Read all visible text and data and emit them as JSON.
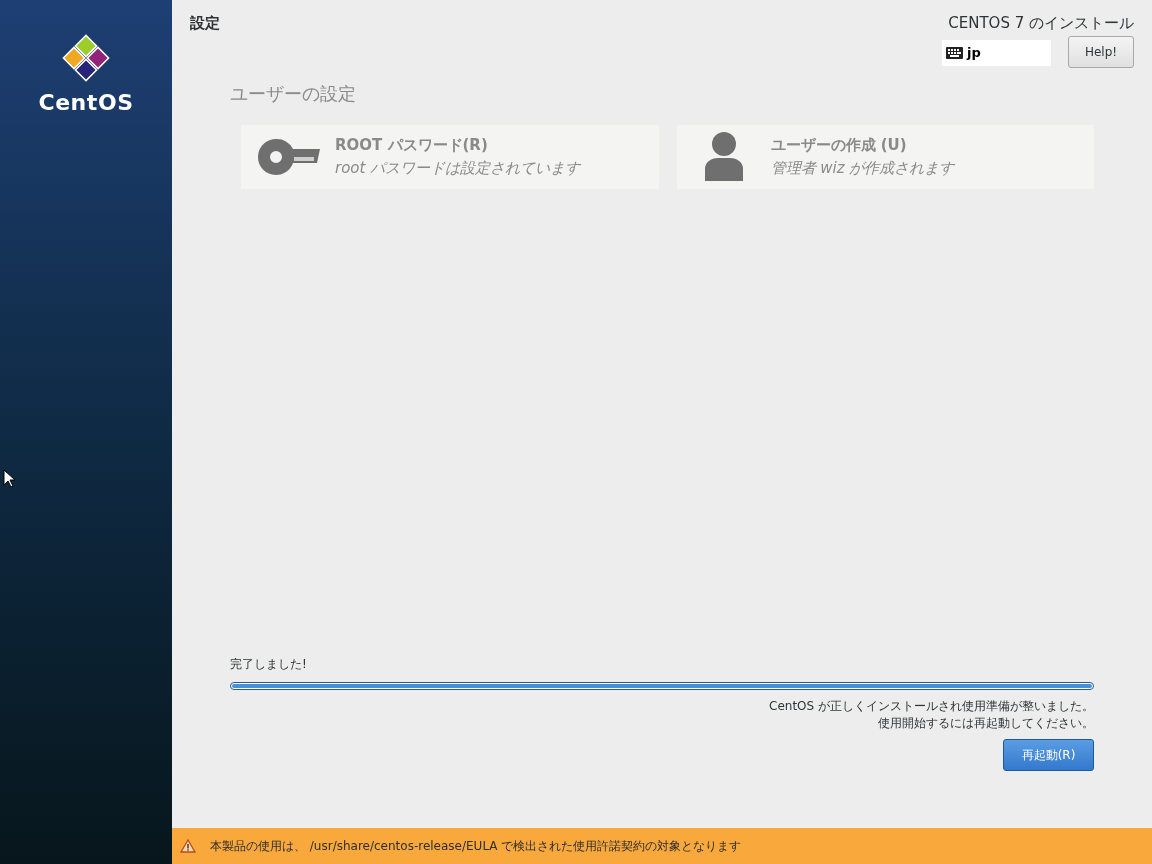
{
  "sidebar": {
    "logo_text": "CentOS"
  },
  "header": {
    "title": "設定",
    "product": "CENTOS 7 のインストール",
    "keyboard": "jp",
    "help_button": "Help!"
  },
  "section_title": "ユーザーの設定",
  "spokes": [
    {
      "kind": "key",
      "title": "ROOT パスワード(R)",
      "status": "root パスワードは設定されています"
    },
    {
      "kind": "user",
      "title": "ユーザーの作成 (U)",
      "status": "管理者 wiz が作成されます"
    }
  ],
  "progress": {
    "label": "完了しました!",
    "level": 1.0,
    "message_lines": [
      "CentOS が正しくインストールされ使用準備が整いました。",
      "使用開始するには再起動してください。"
    ]
  },
  "reboot_button": "再起動(R)",
  "warning_bar": {
    "text": "本製品の使用は、 /usr/share/centos-release/EULA で検出された使用許諾契約の対象となります"
  }
}
